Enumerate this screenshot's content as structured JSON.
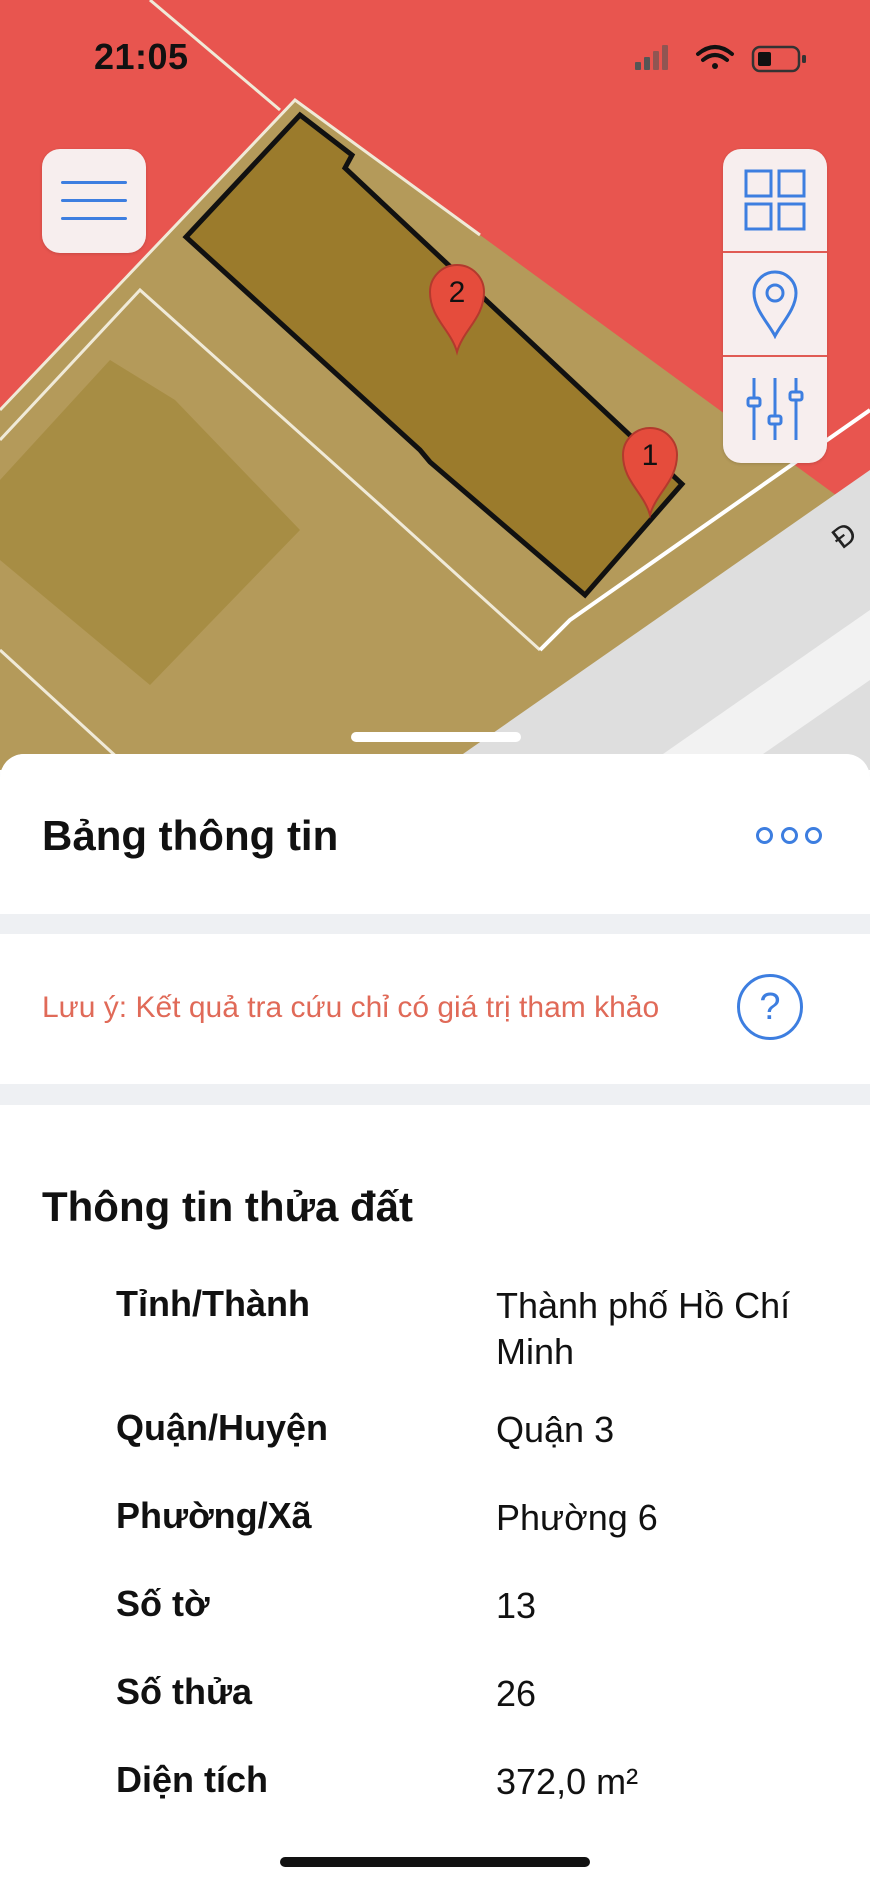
{
  "status_bar": {
    "time": "21:05",
    "icons": [
      "cellular-signal-icon",
      "wifi-icon",
      "battery-low-icon"
    ]
  },
  "map": {
    "background_color": "#e8554f",
    "parcel_color": "#9b7b2c",
    "markers": [
      {
        "label": "1"
      },
      {
        "label": "2"
      }
    ],
    "road_label": "Đ",
    "controls": {
      "menu_icon": "hamburger-menu-icon",
      "tools": [
        "grid-layers-icon",
        "location-pin-icon",
        "sliders-icon"
      ]
    }
  },
  "sheet": {
    "title": "Bảng thông tin",
    "more_icon": "more-dots-icon",
    "note": "Lưu ý: Kết quả tra cứu chỉ có giá trị tham khảo",
    "help_icon": "?",
    "section_title": "Thông tin thửa đất",
    "rows": [
      {
        "label": "Tỉnh/Thành",
        "value": "Thành phố Hồ Chí Minh"
      },
      {
        "label": "Quận/Huyện",
        "value": "Quận 3"
      },
      {
        "label": "Phường/Xã",
        "value": "Phường 6"
      },
      {
        "label": "Số tờ",
        "value": "13"
      },
      {
        "label": "Số thửa",
        "value": "26"
      },
      {
        "label": "Diện tích",
        "value": "372,0 m²"
      }
    ]
  },
  "colors": {
    "accent": "#3d7ee0",
    "warning_text": "#e06a58"
  }
}
